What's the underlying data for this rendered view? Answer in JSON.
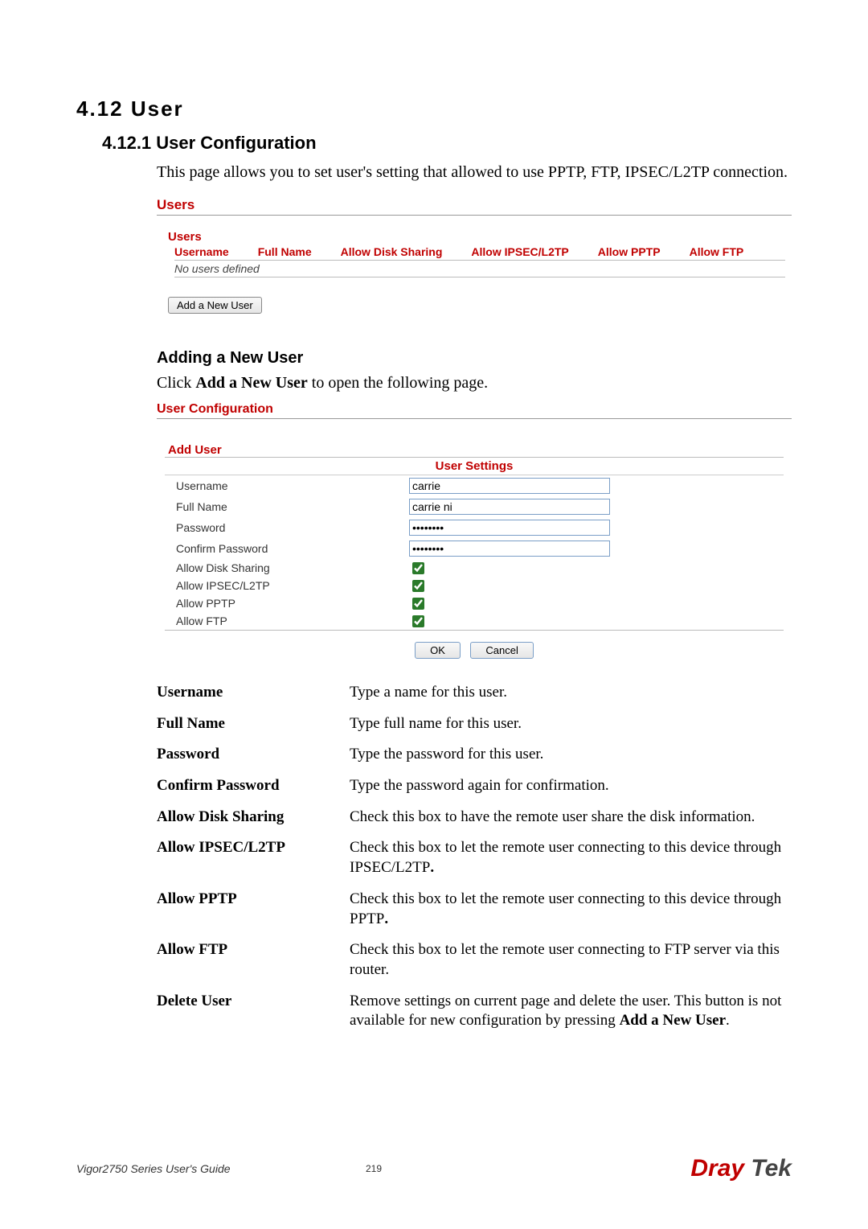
{
  "section": {
    "number_title": "4.12 User",
    "subsection_title": "4.12.1 User Configuration",
    "intro": "This page allows you to set user's setting that allowed to use PPTP, FTP, IPSEC/L2TP connection."
  },
  "users_panel": {
    "title": "Users",
    "subtitle": "Users",
    "headers": {
      "username": "Username",
      "fullname": "Full Name",
      "disk": "Allow Disk Sharing",
      "ipsec": "Allow IPSEC/L2TP",
      "pptp": "Allow PPTP",
      "ftp": "Allow FTP"
    },
    "empty": "No users defined",
    "add_button": "Add a New User"
  },
  "adding": {
    "heading": "Adding a New User",
    "line_pre": "Click ",
    "line_bold": "Add a New User",
    "line_post": " to open the following page."
  },
  "form": {
    "title": "User Configuration",
    "add_user": "Add User",
    "settings_header": "User Settings",
    "labels": {
      "username": "Username",
      "fullname": "Full Name",
      "password": "Password",
      "confirm": "Confirm Password",
      "disk": "Allow Disk Sharing",
      "ipsec": "Allow IPSEC/L2TP",
      "pptp": "Allow PPTP",
      "ftp": "Allow FTP"
    },
    "values": {
      "username": "carrie",
      "fullname": "carrie ni",
      "password": "••••••••",
      "confirm": "••••••••"
    },
    "ok": "OK",
    "cancel": "Cancel"
  },
  "defs": [
    {
      "term": "Username",
      "desc": "Type a name for this user."
    },
    {
      "term": "Full Name",
      "desc": "Type full name for this user."
    },
    {
      "term": "Password",
      "desc": "Type the password for this user."
    },
    {
      "term": "Confirm Password",
      "desc": "Type the password again for confirmation."
    },
    {
      "term": "Allow Disk Sharing",
      "desc": "Check this box to have the remote user share the disk information."
    },
    {
      "term": "Allow IPSEC/L2TP",
      "desc_pre": "Check this box to let the remote user connecting to this device through IPSEC/L2TP",
      "desc_bold": "."
    },
    {
      "term": "Allow PPTP",
      "desc_pre": "Check this box to let the remote user connecting to this device through PPTP",
      "desc_bold": "."
    },
    {
      "term": "Allow FTP",
      "desc": "Check this box to let the remote user connecting to FTP server via this router."
    },
    {
      "term": "Delete User",
      "desc_pre": "Remove settings on current page and delete the user. This button is not available for new configuration by pressing ",
      "desc_bold": "Add a New User",
      "desc_post": "."
    }
  ],
  "footer": {
    "left": "Vigor2750 Series User's Guide",
    "page": "219",
    "logo_a": "Dray",
    "logo_b": " Tek"
  }
}
